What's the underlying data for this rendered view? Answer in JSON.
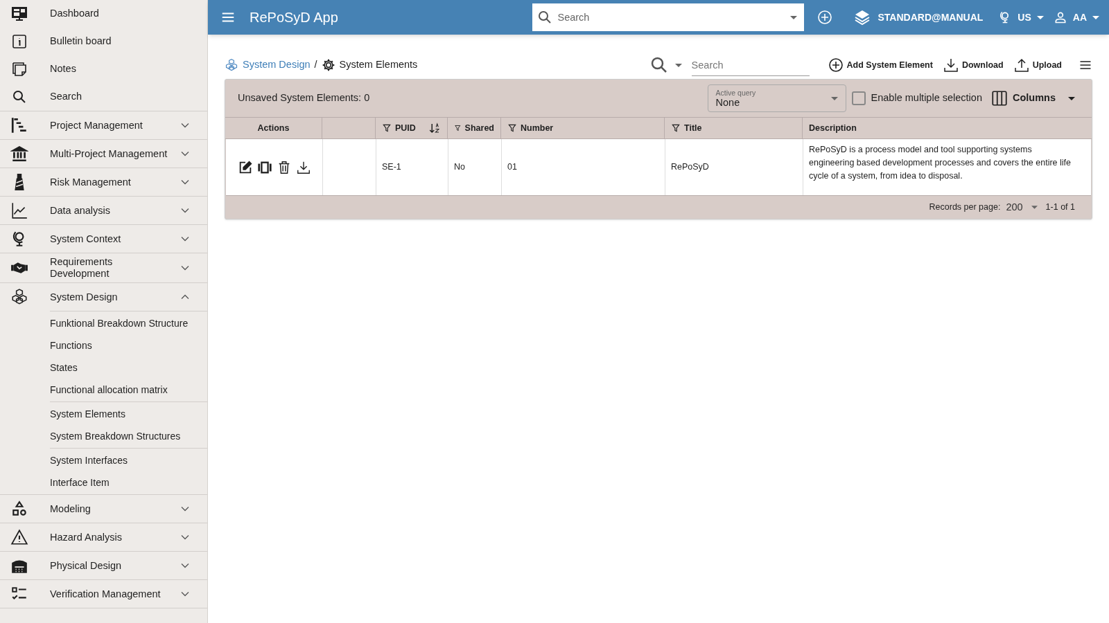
{
  "app_bar": {
    "title": "RePoSyD App",
    "search": {
      "placeholder": "Search"
    },
    "workspace": "STANDARD@MANUAL",
    "locale": "US",
    "user": "AA"
  },
  "sidebar": {
    "items": [
      {
        "kind": "link",
        "label": "Dashboard"
      },
      {
        "kind": "link",
        "label": "Bulletin board"
      },
      {
        "kind": "link",
        "label": "Notes"
      },
      {
        "kind": "link",
        "label": "Search"
      },
      {
        "kind": "group",
        "label": "Project Management",
        "expanded": false
      },
      {
        "kind": "group",
        "label": "Multi-Project Management",
        "expanded": false
      },
      {
        "kind": "group",
        "label": "Risk Management",
        "expanded": false
      },
      {
        "kind": "group",
        "label": "Data analysis",
        "expanded": false
      },
      {
        "kind": "group",
        "label": "System Context",
        "expanded": false
      },
      {
        "kind": "group",
        "label": "Requirements\nDevelopment",
        "expanded": false
      },
      {
        "kind": "group",
        "label": "System Design",
        "expanded": true,
        "sections": [
          {
            "children": [
              {
                "label": "Funktional Breakdown Structure"
              },
              {
                "label": "Functions"
              },
              {
                "label": "States"
              },
              {
                "label": "Functional allocation matrix"
              }
            ]
          },
          {
            "children": [
              {
                "label": "System Elements"
              },
              {
                "label": "System Breakdown Structures"
              }
            ]
          },
          {
            "children": [
              {
                "label": "System Interfaces"
              },
              {
                "label": "Interface Item"
              }
            ]
          }
        ]
      },
      {
        "kind": "group",
        "label": "Modeling",
        "expanded": false
      },
      {
        "kind": "group",
        "label": "Hazard Analysis",
        "expanded": false
      },
      {
        "kind": "group",
        "label": "Physical Design",
        "expanded": false
      },
      {
        "kind": "group",
        "label": "Verification Management",
        "expanded": false
      }
    ]
  },
  "breadcrumb": {
    "parent": "System Design",
    "separator": "/",
    "current": "System Elements"
  },
  "toolbar": {
    "search": {
      "placeholder": "Search"
    },
    "actions": [
      {
        "label": "Add System Element"
      },
      {
        "label": "Download"
      },
      {
        "label": "Upload"
      }
    ]
  },
  "table_panel": {
    "unsaved": "Unsaved System Elements: 0",
    "active_query": {
      "label": "Active query",
      "value": "None"
    },
    "multiple_selection": {
      "label": "Enable multiple selection",
      "checked": false
    },
    "columns_button": "Columns",
    "columns": [
      {
        "label": "Actions",
        "filter": false,
        "sort": false
      },
      {},
      {
        "label": "PUID",
        "filter": true,
        "sort": true
      },
      {
        "label": "Shared",
        "filter": true,
        "sort": false
      },
      {
        "label": "Number",
        "filter": true,
        "sort": false
      },
      {
        "label": "Title",
        "filter": true,
        "sort": false
      },
      {
        "label": "Description",
        "filter": false,
        "sort": false
      }
    ],
    "rows": [
      {
        "cells": [
          "",
          "",
          "SE-1",
          "No",
          "01",
          "RePoSyD",
          "RePoSyD is a process model and tool supporting systems engineering based development processes and covers the entire life cycle of a system, from idea to disposal."
        ]
      }
    ],
    "footer": {
      "records_label": "Records per page:",
      "records_value": "200",
      "range": "1-1 of 1"
    }
  }
}
